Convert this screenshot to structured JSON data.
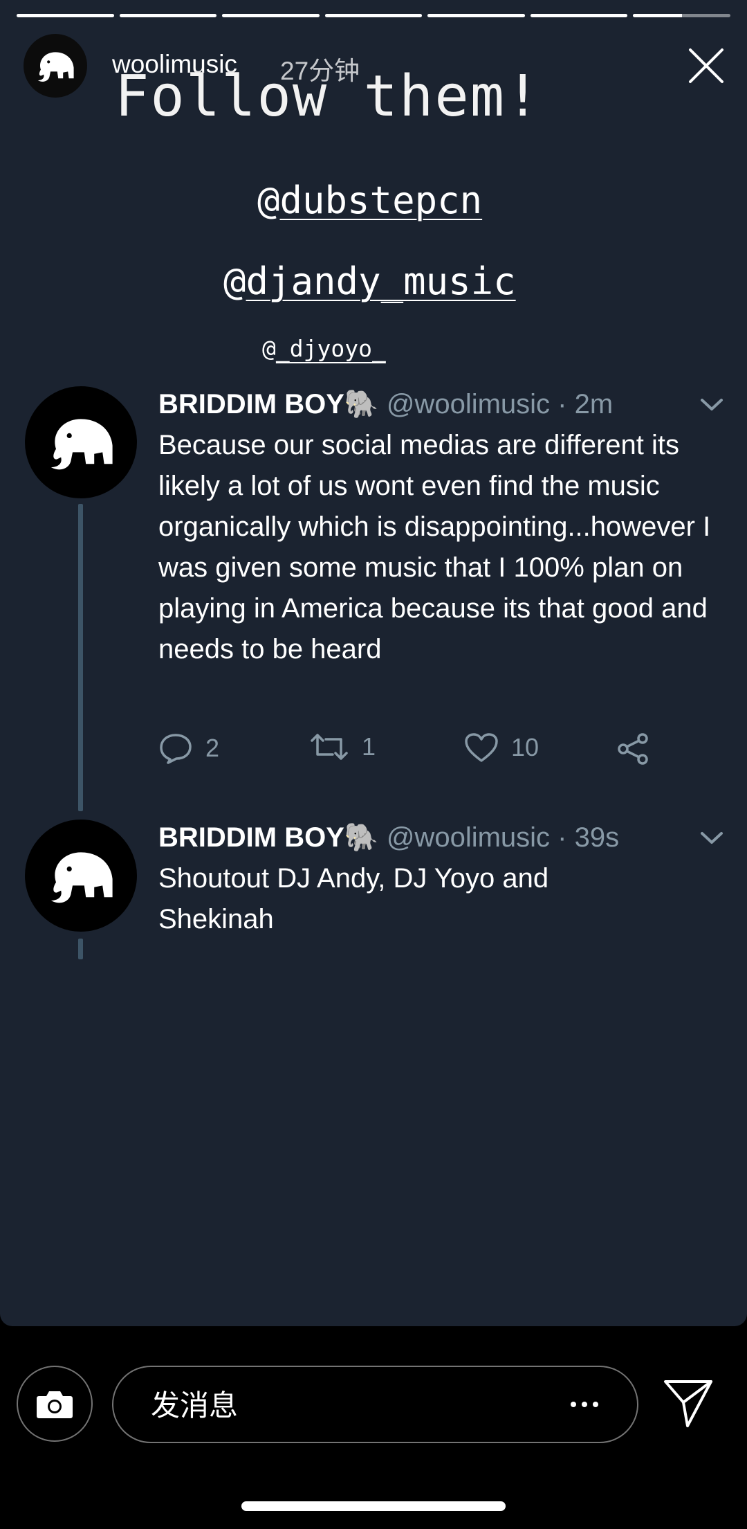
{
  "story": {
    "progress": [
      1,
      1,
      1,
      1,
      1,
      1,
      0.5
    ],
    "username": "woolimusic",
    "time": "27分钟"
  },
  "overlay": {
    "title": "Follow them!",
    "tags": [
      {
        "at": "@",
        "name": "dubstepcn"
      },
      {
        "at": "@",
        "name": "djandy_music"
      },
      {
        "at": "@",
        "name": "_djyoyo_"
      }
    ]
  },
  "tweets": [
    {
      "name": "BRIDDIM BOY",
      "emoji": "🐘",
      "handle_time": "@woolimusic · 2m",
      "text": "Because our social medias are different its likely a lot of us wont even find the music organically which is disappointing...however I was given some music that I 100% plan on playing in America because its that good and needs to be heard",
      "replies": "2",
      "retweets": "1",
      "likes": "10"
    },
    {
      "name": "BRIDDIM BOY",
      "emoji": "🐘",
      "handle_time": "@woolimusic · 39s",
      "text": "Shoutout DJ Andy, DJ Yoyo and Shekinah"
    }
  ],
  "composer": {
    "placeholder": "发消息"
  }
}
